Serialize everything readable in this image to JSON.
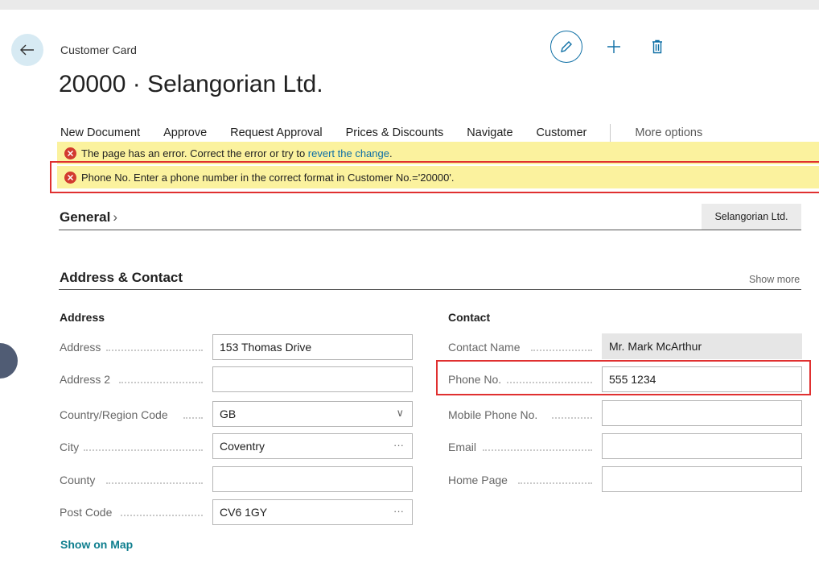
{
  "page": {
    "caption": "Customer Card",
    "title": "20000 · Selangorian Ltd."
  },
  "actions": {
    "edit_icon": "pencil-icon",
    "new_icon": "plus-icon",
    "delete_icon": "trash-icon"
  },
  "menu": {
    "items": [
      "New Document",
      "Approve",
      "Request Approval",
      "Prices & Discounts",
      "Navigate",
      "Customer"
    ],
    "more": "More options"
  },
  "errors": {
    "page_error_text": "The page has an error. Correct the error or try to ",
    "revert_link": "revert the change",
    "page_error_end": ".",
    "phone_error": "Phone No. Enter a phone number in the correct format in Customer No.='20000'."
  },
  "general": {
    "title": "General",
    "chevron": "›",
    "factbox": "Selangorian Ltd."
  },
  "address_contact": {
    "title": "Address & Contact",
    "show_more": "Show more",
    "address": {
      "title": "Address",
      "address_label": "Address",
      "address_value": "153 Thomas Drive",
      "address2_label": "Address 2",
      "address2_value": "",
      "country_label": "Country/Region Code",
      "country_value": "GB",
      "city_label": "City",
      "city_value": "Coventry",
      "county_label": "County",
      "county_value": "",
      "post_code_label": "Post Code",
      "post_code_value": "CV6 1GY",
      "lookup": "···",
      "dropdown": "∨"
    },
    "contact": {
      "title": "Contact",
      "contact_name_label": "Contact Name",
      "contact_name_value": "Mr. Mark McArthur",
      "phone_label": "Phone No.",
      "phone_value": "555 1234",
      "mobile_label": "Mobile Phone No.",
      "mobile_value": "",
      "email_label": "Email",
      "email_value": "",
      "home_page_label": "Home Page",
      "home_page_value": ""
    },
    "show_on_map": "Show on Map"
  },
  "colors": {
    "accent": "#0e6fa5",
    "error_bg": "#fbf29e",
    "error_icon": "#d23a2f",
    "highlight": "#e03030"
  }
}
